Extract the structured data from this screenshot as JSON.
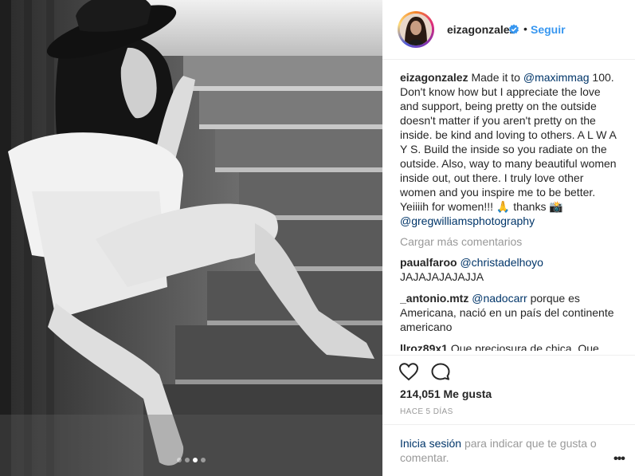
{
  "header": {
    "username": "eizagonzalez",
    "separator": "•",
    "follow_label": "Seguir"
  },
  "caption": {
    "username": "eizagonzalez",
    "text_1": "Made it to",
    "mention_1": "@maximmag",
    "text_2": "100. Don't know how but I appreciate the love and support, being pretty on the outside doesn't matter if you aren't pretty on the inside. be kind and loving to others. A L W A Y S. Build the inside so you radiate on the outside. Also, way to many beautiful women inside out, out there. I truly love other women and you inspire me to be better. Yeiiiih for women!!! 🙏 thanks 📸",
    "mention_2": "@gregwilliamsphotography"
  },
  "load_more_label": "Cargar más comentarios",
  "comments": [
    {
      "username": "paualfaroo",
      "mention": "@christadelhoyo",
      "text": "JAJAJAJAJAJJA"
    },
    {
      "username": "_antonio.mtz",
      "mention": "@nadocarr",
      "text": "porque es Americana, nació en un país del continente americano"
    },
    {
      "username": "llroz89x1",
      "mention": "",
      "text": "Que preciosura de chica. Que"
    }
  ],
  "likes_label": "214,051 Me gusta",
  "time_label": "HACE 5 DÍAS",
  "login": {
    "link": "Inicia sesión",
    "text": "para indicar que te gusta o comentar."
  },
  "more_label": "•••",
  "carousel": {
    "count": 4,
    "active": 3
  },
  "colors": {
    "link_blue": "#3897f0",
    "mention_navy": "#003569",
    "muted_gray": "#999999",
    "text": "#262626"
  },
  "icons": [
    "verified-badge-icon",
    "heart-icon",
    "comment-icon",
    "more-options-icon"
  ]
}
